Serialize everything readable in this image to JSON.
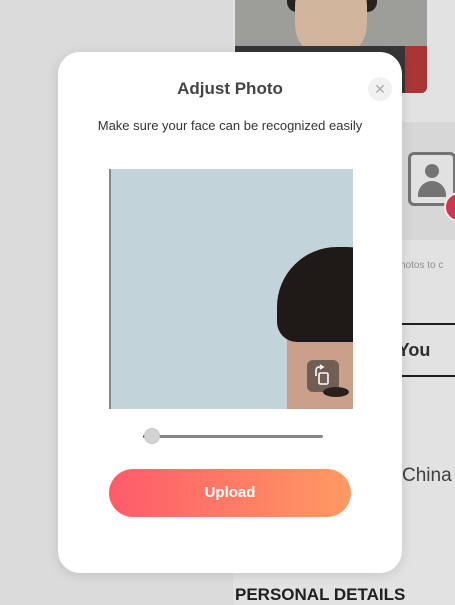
{
  "modal": {
    "title": "Adjust Photo",
    "close_icon": "close-icon",
    "subtitle": "Make sure your face can be recognized easily",
    "rotate_icon": "rotate-icon",
    "zoom_level": 0.05,
    "upload_label": "Upload",
    "colors": {
      "upload_gradient_start": "#ff5b6a",
      "upload_gradient_end": "#ff9a62"
    }
  },
  "background": {
    "add_photo_icon": "avatar-placeholder-icon",
    "add_icon": "plus-icon",
    "photos_hint": "hotos to c",
    "tab_label": "w You",
    "country_value": "China",
    "section_title": "PERSONAL DETAILS"
  }
}
